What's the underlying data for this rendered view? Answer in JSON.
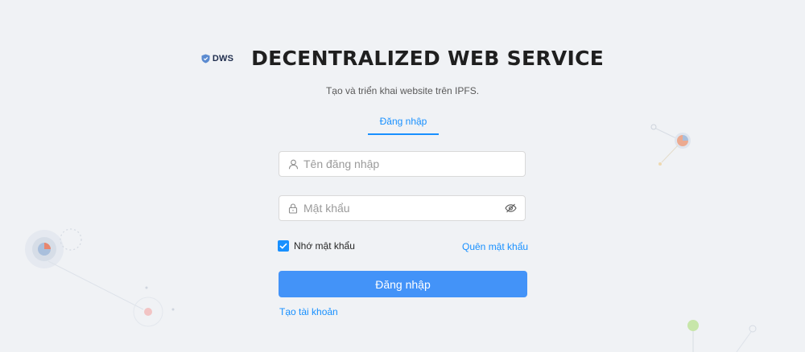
{
  "brand": {
    "logo_text": "DWS",
    "title": "DECENTRALIZED WEB SERVICE",
    "description": "Tạo và triển khai website trên IPFS."
  },
  "tabs": [
    {
      "label": "Đăng nhập",
      "active": true
    }
  ],
  "form": {
    "username": {
      "placeholder": "Tên đăng nhập",
      "value": "",
      "icon": "user-icon"
    },
    "password": {
      "placeholder": "Mật khẩu",
      "value": "",
      "icon": "lock-icon",
      "toggle_icon": "eye-invisible-icon"
    },
    "remember": {
      "label": "Nhớ mật khẩu",
      "checked": true
    },
    "forgot_label": "Quên mật khẩu",
    "submit_label": "Đăng nhập",
    "register_label": "Tạo tài khoản"
  },
  "colors": {
    "primary": "#1890ff",
    "button": "#4393f8",
    "background": "#f0f2f5"
  }
}
